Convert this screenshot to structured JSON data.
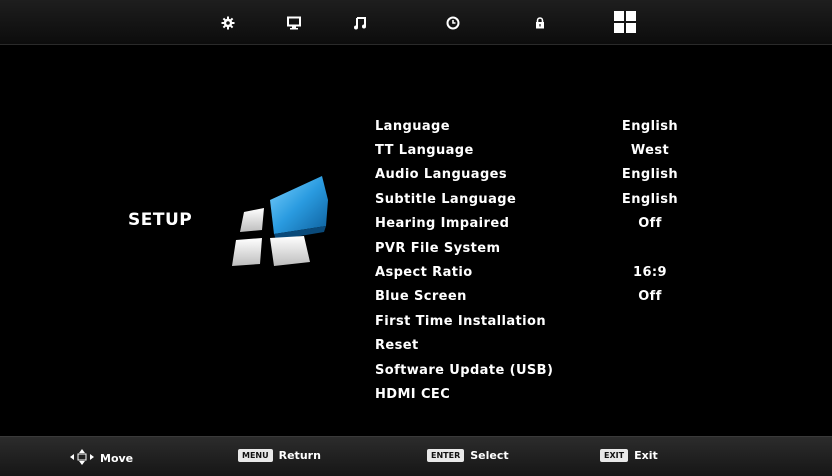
{
  "tabs": [
    {
      "icon": "gear-icon"
    },
    {
      "icon": "monitor-icon"
    },
    {
      "icon": "music-note-icon"
    },
    {
      "icon": "clock-icon"
    },
    {
      "icon": "lock-icon"
    },
    {
      "icon": "setup-grid-icon",
      "selected": true
    }
  ],
  "page": {
    "title": "SETUP"
  },
  "menu": {
    "items": [
      {
        "label": "Language",
        "value": "English"
      },
      {
        "label": "TT Language",
        "value": "West"
      },
      {
        "label": "Audio Languages",
        "value": "English"
      },
      {
        "label": "Subtitle Language",
        "value": "English"
      },
      {
        "label": "Hearing Impaired",
        "value": "Off"
      },
      {
        "label": "PVR File System",
        "value": ""
      },
      {
        "label": "Aspect Ratio",
        "value": "16:9"
      },
      {
        "label": "Blue Screen",
        "value": "Off"
      },
      {
        "label": "First Time Installation",
        "value": ""
      },
      {
        "label": "Reset",
        "value": ""
      },
      {
        "label": "Software Update (USB)",
        "value": ""
      },
      {
        "label": "HDMI CEC",
        "value": ""
      }
    ]
  },
  "footer": {
    "move_label": "Move",
    "return_key": "MENU",
    "return_label": "Return",
    "select_key": "ENTER",
    "select_label": "Select",
    "exit_key": "EXIT",
    "exit_label": "Exit"
  },
  "colors": {
    "accent": "#2a9be0",
    "background": "#000000",
    "text": "#ffffff"
  }
}
